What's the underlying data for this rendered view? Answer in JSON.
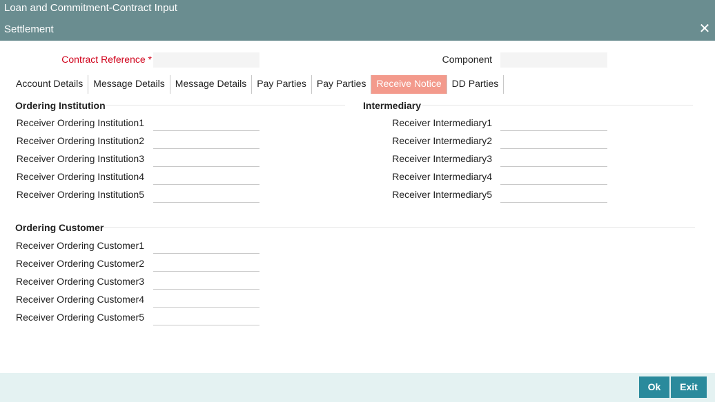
{
  "window": {
    "title": "Loan and Commitment-Contract Input"
  },
  "dialog": {
    "title": "Settlement",
    "close_glyph": "✕"
  },
  "header": {
    "contract_reference_label": "Contract Reference *",
    "contract_reference_value": "",
    "component_label": "Component",
    "component_value": ""
  },
  "tabs": [
    {
      "label": "Account Details"
    },
    {
      "label": "Message Details"
    },
    {
      "label": "Message Details"
    },
    {
      "label": "Pay Parties"
    },
    {
      "label": "Pay Parties"
    },
    {
      "label": "Receive Notice"
    },
    {
      "label": "DD Parties"
    }
  ],
  "ordering_institution": {
    "title": "Ordering Institution",
    "fields": [
      {
        "label": "Receiver Ordering Institution1",
        "value": ""
      },
      {
        "label": "Receiver Ordering Institution2",
        "value": ""
      },
      {
        "label": "Receiver Ordering Institution3",
        "value": ""
      },
      {
        "label": "Receiver Ordering Institution4",
        "value": ""
      },
      {
        "label": "Receiver Ordering Institution5",
        "value": ""
      }
    ]
  },
  "intermediary": {
    "title": "Intermediary",
    "fields": [
      {
        "label": "Receiver Intermediary1",
        "value": ""
      },
      {
        "label": "Receiver Intermediary2",
        "value": ""
      },
      {
        "label": "Receiver Intermediary3",
        "value": ""
      },
      {
        "label": "Receiver Intermediary4",
        "value": ""
      },
      {
        "label": "Receiver Intermediary5",
        "value": ""
      }
    ]
  },
  "ordering_customer": {
    "title": "Ordering Customer",
    "fields": [
      {
        "label": "Receiver Ordering Customer1",
        "value": ""
      },
      {
        "label": "Receiver Ordering Customer2",
        "value": ""
      },
      {
        "label": "Receiver Ordering Customer3",
        "value": ""
      },
      {
        "label": "Receiver Ordering Customer4",
        "value": ""
      },
      {
        "label": "Receiver Ordering Customer5",
        "value": ""
      }
    ]
  },
  "footer": {
    "ok_label": "Ok",
    "exit_label": "Exit"
  },
  "colors": {
    "title_bar": "#6a8d90",
    "active_tab": "#f39a8c",
    "button": "#2a8a9c",
    "footer": "#e4f2f2"
  }
}
